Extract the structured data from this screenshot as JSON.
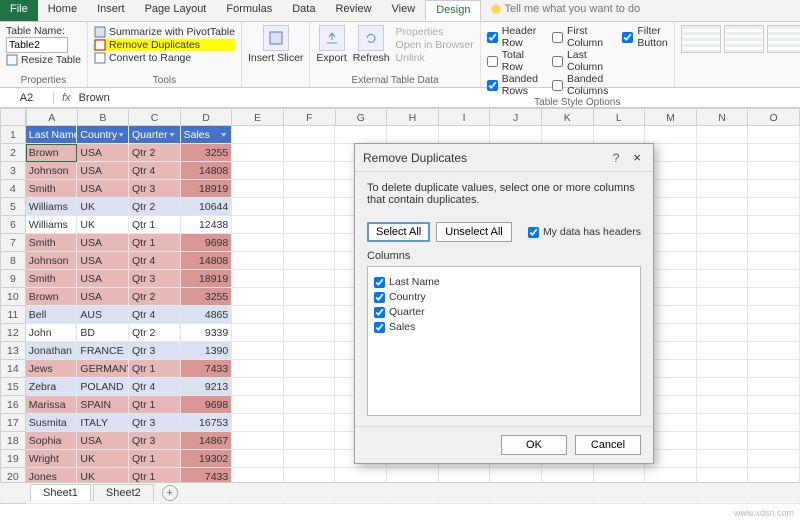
{
  "tabs": [
    "File",
    "Home",
    "Insert",
    "Page Layout",
    "Formulas",
    "Data",
    "Review",
    "View",
    "Design"
  ],
  "tell_me": "Tell me what you want to do",
  "ribbon": {
    "table_name_label": "Table Name:",
    "table_name_value": "Table2",
    "resize": "Resize Table",
    "properties_label": "Properties",
    "summarize": "Summarize with PivotTable",
    "remove_dup": "Remove Duplicates",
    "convert": "Convert to Range",
    "tools_label": "Tools",
    "insert_slicer": "Insert\nSlicer",
    "export": "Export",
    "refresh": "Refresh",
    "ext_props": "Properties",
    "open_browser": "Open in Browser",
    "unlink": "Unlink",
    "external_label": "External Table Data",
    "header_row": "Header Row",
    "total_row": "Total Row",
    "banded_rows": "Banded Rows",
    "first_col": "First Column",
    "last_col": "Last Column",
    "banded_cols": "Banded Columns",
    "filter_btn": "Filter Button",
    "style_opts_label": "Table Style Options"
  },
  "namebox": "A2",
  "fx_value": "Brown",
  "columns": [
    "A",
    "B",
    "C",
    "D",
    "E",
    "F",
    "G",
    "H",
    "I",
    "J",
    "K",
    "L",
    "M",
    "N",
    "O"
  ],
  "chart_data": {
    "type": "table",
    "headers": [
      "Last Name",
      "Country",
      "Quarter",
      "Sales"
    ],
    "rows": [
      {
        "r": 2,
        "dup": true,
        "cells": [
          "Brown",
          "USA",
          "Qtr 2",
          "3255"
        ]
      },
      {
        "r": 3,
        "dup": true,
        "cells": [
          "Johnson",
          "USA",
          "Qtr 4",
          "14808"
        ]
      },
      {
        "r": 4,
        "dup": true,
        "cells": [
          "Smith",
          "USA",
          "Qtr 3",
          "18919"
        ]
      },
      {
        "r": 5,
        "dup": false,
        "cells": [
          "Williams",
          "UK",
          "Qtr 2",
          "10644"
        ]
      },
      {
        "r": 6,
        "dup": false,
        "cells": [
          "Williams",
          "UK",
          "Qtr 1",
          "12438"
        ]
      },
      {
        "r": 7,
        "dup": true,
        "cells": [
          "Smith",
          "USA",
          "Qtr 1",
          "9698"
        ]
      },
      {
        "r": 8,
        "dup": true,
        "cells": [
          "Johnson",
          "USA",
          "Qtr 4",
          "14808"
        ]
      },
      {
        "r": 9,
        "dup": true,
        "cells": [
          "Smith",
          "USA",
          "Qtr 3",
          "18919"
        ]
      },
      {
        "r": 10,
        "dup": true,
        "cells": [
          "Brown",
          "USA",
          "Qtr 2",
          "3255"
        ]
      },
      {
        "r": 11,
        "dup": false,
        "cells": [
          "Bell",
          "AUS",
          "Qtr 4",
          "4865"
        ]
      },
      {
        "r": 12,
        "dup": false,
        "cells": [
          "John",
          "BD",
          "Qtr 2",
          "9339"
        ]
      },
      {
        "r": 13,
        "dup": false,
        "cells": [
          "Jonathan",
          "FRANCE",
          "Qtr 3",
          "1390"
        ]
      },
      {
        "r": 14,
        "dup": true,
        "cells": [
          "Jews",
          "GERMANY",
          "Qtr 1",
          "7433"
        ]
      },
      {
        "r": 15,
        "dup": false,
        "cells": [
          "Zebra",
          "POLAND",
          "Qtr 4",
          "9213"
        ]
      },
      {
        "r": 16,
        "dup": true,
        "cells": [
          "Marissa",
          "SPAIN",
          "Qtr 1",
          "9698"
        ]
      },
      {
        "r": 17,
        "dup": false,
        "cells": [
          "Susmita",
          "ITALY",
          "Qtr 3",
          "16753"
        ]
      },
      {
        "r": 18,
        "dup": true,
        "cells": [
          "Sophia",
          "USA",
          "Qtr 3",
          "14867"
        ]
      },
      {
        "r": 19,
        "dup": true,
        "cells": [
          "Wright",
          "UK",
          "Qtr 1",
          "19302"
        ]
      },
      {
        "r": 20,
        "dup": true,
        "cells": [
          "Jones",
          "UK",
          "Qtr 1",
          "7433"
        ]
      }
    ]
  },
  "dialog": {
    "title": "Remove Duplicates",
    "desc": "To delete duplicate values, select one or more columns that contain duplicates.",
    "select_all": "Select All",
    "unselect_all": "Unselect All",
    "my_data_headers": "My data has headers",
    "columns_label": "Columns",
    "cols": [
      "Last Name",
      "Country",
      "Quarter",
      "Sales"
    ],
    "ok": "OK",
    "cancel": "Cancel"
  },
  "sheets": [
    "Sheet1",
    "Sheet2"
  ]
}
